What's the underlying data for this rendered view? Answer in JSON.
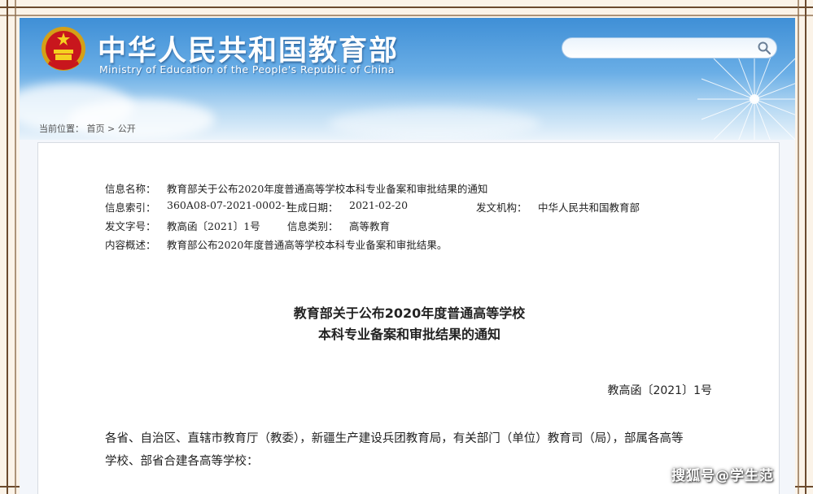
{
  "header": {
    "title": "中华人民共和国教育部",
    "subtitle": "Ministry of Education of the People's Republic of China",
    "search": {
      "placeholder": "",
      "icon": "search-icon"
    }
  },
  "breadcrumb": {
    "prefix": "当前位置：",
    "home": "首页",
    "separator": ">",
    "current": "公开"
  },
  "metadata": {
    "name_label": "信息名称：",
    "name_value": "教育部关于公布2020年度普通高等学校本科专业备案和审批结果的通知",
    "index_label": "信息索引：",
    "index_value": "360A08-07-2021-0002-1",
    "date_label": "生成日期：",
    "date_value": "2021-02-20",
    "org_label": "发文机构：",
    "org_value": "中华人民共和国教育部",
    "docno_label": "发文字号：",
    "docno_value": "教高函〔2021〕1号",
    "category_label": "信息类别：",
    "category_value": "高等教育",
    "summary_label": "内容概述：",
    "summary_value": "教育部公布2020年度普通高等学校本科专业备案和审批结果。"
  },
  "document": {
    "title_line1": "教育部关于公布2020年度普通高等学校",
    "title_line2": "本科专业备案和审批结果的通知",
    "doc_number": "教高函〔2021〕1号",
    "body_line1": "各省、自治区、直辖市教育厅（教委），新疆生产建设兵团教育局，有关部门（单位）教育司（局），部属各高等",
    "body_line2": "学校、部省合建各高等学校："
  },
  "watermark": "搜狐号@学生范",
  "colors": {
    "header_blue": "#3f8fd6",
    "frame_brown": "#6b4a2e",
    "page_bg": "#fbf3e8"
  }
}
